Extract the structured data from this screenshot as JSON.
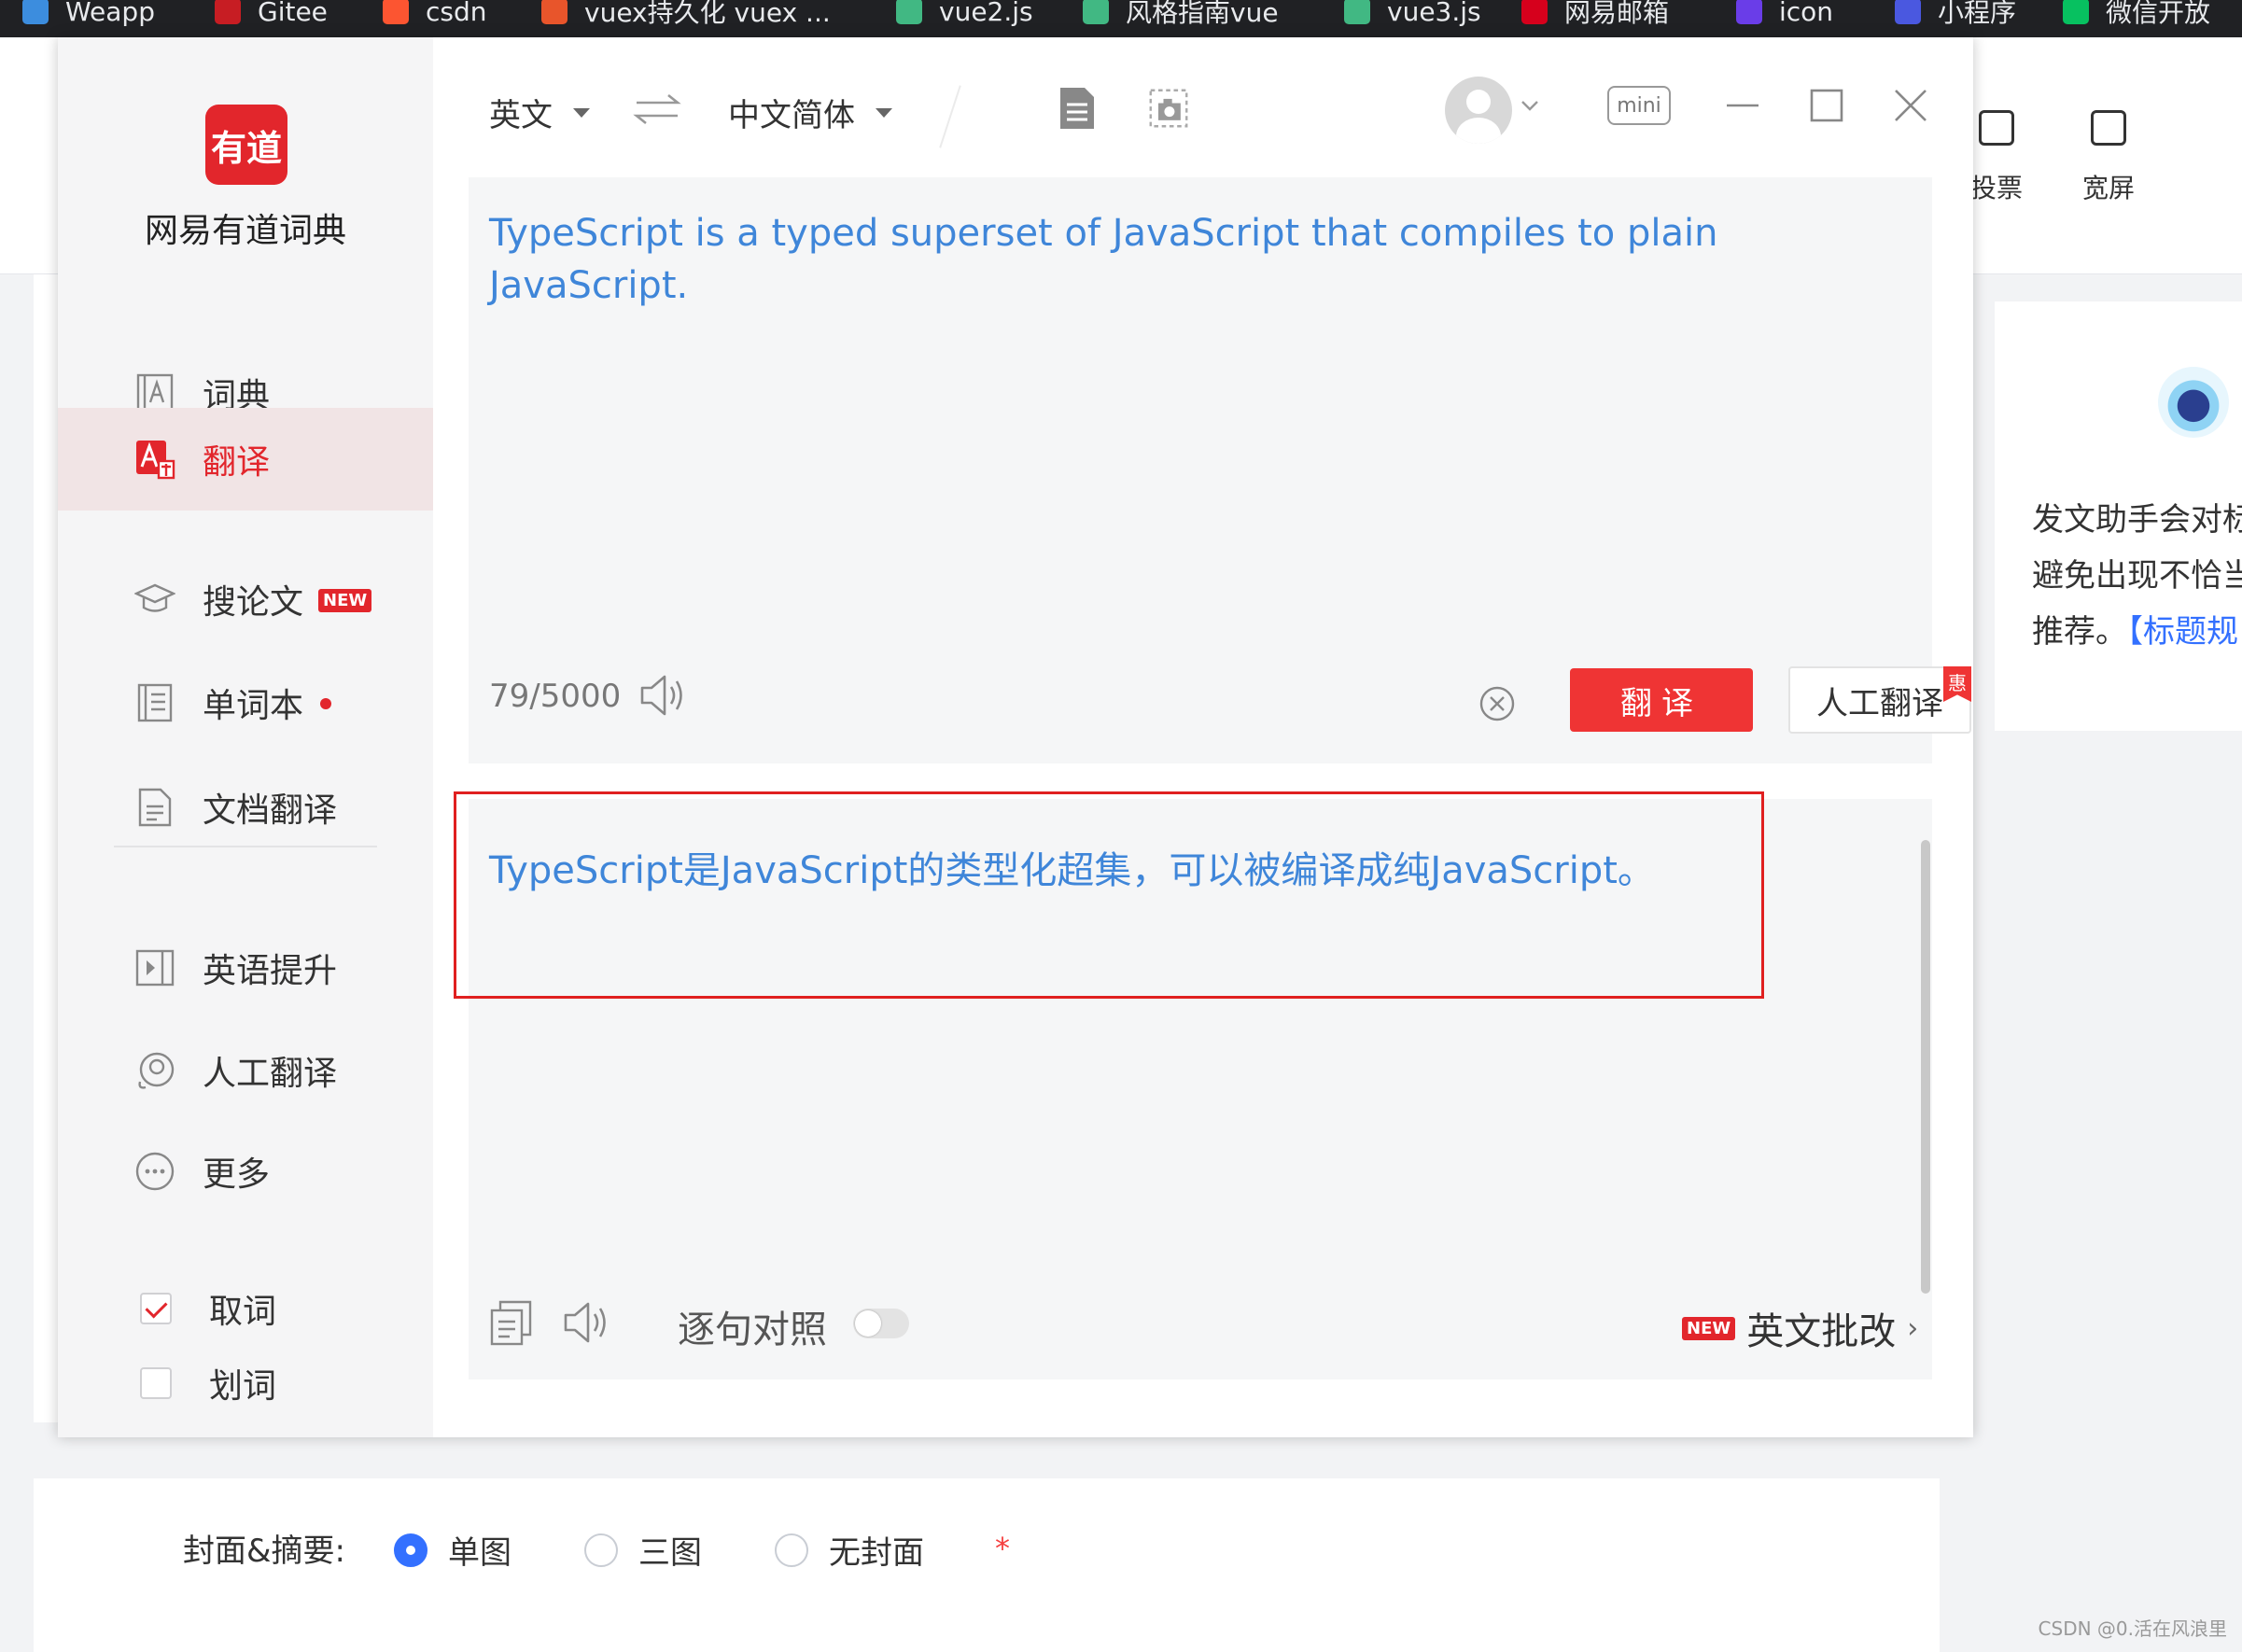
{
  "bookmarks": [
    {
      "label": "Weapp",
      "color": "#3c8dde"
    },
    {
      "label": "Gitee",
      "color": "#c71d23"
    },
    {
      "label": "csdn",
      "color": "#fc5531"
    },
    {
      "label": "vuex持久化 vuex ...",
      "color": "#e8552b"
    },
    {
      "label": "vue2.js",
      "color": "#41b883"
    },
    {
      "label": "风格指南vue",
      "color": "#41b883"
    },
    {
      "label": "vue3.js",
      "color": "#41b883"
    },
    {
      "label": "网易邮箱",
      "color": "#d6001c"
    },
    {
      "label": "icon",
      "color": "#6a3de8"
    },
    {
      "label": "小程序",
      "color": "#4a58e0"
    },
    {
      "label": "微信开放",
      "color": "#07c160"
    }
  ],
  "background": {
    "header_items": [
      {
        "label": "投票"
      },
      {
        "label": "宽屏"
      }
    ],
    "assistant_tip": {
      "lines": [
        "发文助手会对标",
        "避免出现不恰当",
        "推荐。"
      ],
      "link": "【标题规"
    },
    "cover": {
      "label": "封面&摘要:",
      "options": [
        {
          "label": "单图",
          "checked": true
        },
        {
          "label": "三图",
          "checked": false
        },
        {
          "label": "无封面",
          "checked": false
        }
      ],
      "required_mark": "*"
    },
    "watermark": "CSDN @0.活在风浪里"
  },
  "youdao": {
    "logo_text": "有道",
    "app_name": "网易有道词典",
    "nav": [
      {
        "label": "词典",
        "icon": "dictionary-icon",
        "active": false
      },
      {
        "label": "翻译",
        "icon": "translate-icon",
        "active": true
      },
      {
        "label": "搜论文",
        "icon": "graduation-cap-icon",
        "active": false,
        "badge": "NEW"
      },
      {
        "label": "单词本",
        "icon": "wordbook-icon",
        "active": false,
        "dot": true
      },
      {
        "label": "文档翻译",
        "icon": "document-icon",
        "active": false
      },
      {
        "label": "英语提升",
        "icon": "play-video-icon",
        "active": false
      },
      {
        "label": "人工翻译",
        "icon": "human-translate-icon",
        "active": false
      },
      {
        "label": "更多",
        "icon": "more-icon",
        "active": false
      }
    ],
    "checks": [
      {
        "label": "取词",
        "checked": true
      },
      {
        "label": "划词",
        "checked": false
      }
    ],
    "toolbar": {
      "source_lang": "英文",
      "target_lang": "中文简体",
      "mini_label": "mini"
    },
    "input": {
      "text": "TypeScript is a typed superset of JavaScript that compiles to plain JavaScript.",
      "char_count": "79/5000",
      "translate_label": "翻译",
      "human_label": "人工翻译",
      "promo_tag": "惠"
    },
    "output": {
      "text": "TypeScript是JavaScript的类型化超集，可以被编译成纯JavaScript。",
      "sentence_label": "逐句对照",
      "sentence_enabled": false,
      "essay_badge": "NEW",
      "essay_label": "英文批改"
    },
    "colors": {
      "brand": "#e2262c",
      "translate_button": "#ef3434",
      "text_blue": "#3f86d9",
      "highlight_border": "#e02020"
    }
  }
}
